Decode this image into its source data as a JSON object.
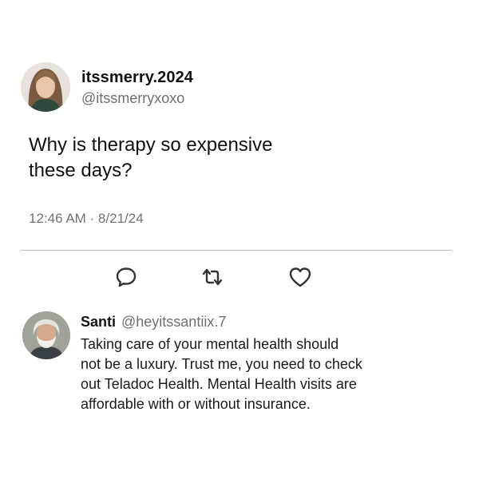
{
  "post": {
    "author": {
      "display_name": "itssmerry.2024",
      "handle": "@itssmerryxoxo",
      "avatar_icon": "user-avatar-woman"
    },
    "text_line1": "Why is therapy so expensive",
    "text_line2": "these days?",
    "timestamp": "12:46 AM · 8/21/24"
  },
  "actions": [
    {
      "name": "reply",
      "icon": "speech-bubble-icon"
    },
    {
      "name": "repost",
      "icon": "repost-arrows-icon"
    },
    {
      "name": "like",
      "icon": "heart-icon"
    }
  ],
  "reply": {
    "author": {
      "display_name": "Santi",
      "handle": "@heyitssantiix.7",
      "avatar_icon": "user-avatar-man"
    },
    "lines": [
      "Taking care of your mental health should",
      "not be a luxury. Trust me, you need to check",
      "out Teladoc Health. Mental Health visits are",
      "affordable with or without insurance."
    ]
  },
  "colors": {
    "text": "#0f1419",
    "secondary": "#6b6f73",
    "divider": "#b9bcbf",
    "icon": "#333333"
  }
}
